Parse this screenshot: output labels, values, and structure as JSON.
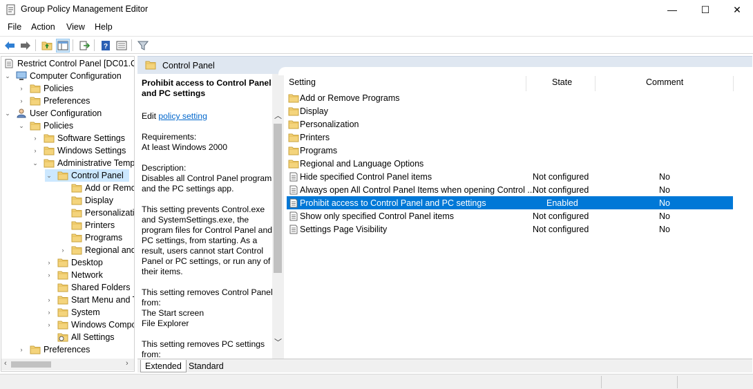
{
  "window": {
    "title": "Group Policy Management Editor",
    "minimize": "—",
    "maximize": "☐",
    "close": "✕"
  },
  "menu": [
    "File",
    "Action",
    "View",
    "Help"
  ],
  "toolbar": [
    "back-icon",
    "forward-icon",
    "up-folder-icon",
    "show-hide-tree-icon",
    "export-list-icon",
    "help-icon",
    "properties-icon",
    "filter-icon"
  ],
  "tree": {
    "root": "Restrict Control Panel [DC01.CC",
    "computer_config": "Computer Configuration",
    "policies": "Policies",
    "preferences": "Preferences",
    "user_config": "User Configuration",
    "software_settings": "Software Settings",
    "windows_settings": "Windows Settings",
    "admin_templates": "Administrative Temp",
    "control_panel": "Control Panel",
    "children": [
      "Add or Remo",
      "Display",
      "Personalizatic",
      "Printers",
      "Programs",
      "Regional and"
    ],
    "desktop": "Desktop",
    "network": "Network",
    "shared_folders": "Shared Folders",
    "start_menu": "Start Menu and T",
    "system": "System",
    "windows_components": "Windows Compc",
    "all_settings": "All Settings",
    "preferences2": "Preferences"
  },
  "header": {
    "title": "Control Panel"
  },
  "description": {
    "heading": "Prohibit access to Control Panel and PC settings",
    "edit_prefix": "Edit ",
    "edit_link": "policy setting ",
    "requirements": "Requirements:\nAt least Windows 2000",
    "description": "Description:\nDisables all Control Panel programs and the PC settings app.",
    "para1": "This setting prevents Control.exe and SystemSettings.exe, the program files for Control Panel and PC settings, from starting. As a result, users cannot start Control Panel or PC settings, or run any of their items.",
    "para2": "This setting removes Control Panel from:\nThe Start screen\nFile Explorer",
    "para3": "This setting removes PC settings from:"
  },
  "columns": {
    "setting": "Setting",
    "state": "State",
    "comment": "Comment"
  },
  "folders": [
    "Add or Remove Programs",
    "Display",
    "Personalization",
    "Printers",
    "Programs",
    "Regional and Language Options"
  ],
  "settings": [
    {
      "name": "Hide specified Control Panel items",
      "state": "Not configured",
      "comment": "No"
    },
    {
      "name": "Always open All Control Panel Items when opening Control ...",
      "state": "Not configured",
      "comment": "No"
    },
    {
      "name": "Prohibit access to Control Panel and PC settings",
      "state": "Enabled",
      "comment": "No"
    },
    {
      "name": "Show only specified Control Panel items",
      "state": "Not configured",
      "comment": "No"
    },
    {
      "name": "Settings Page Visibility",
      "state": "Not configured",
      "comment": "No"
    }
  ],
  "tabs": {
    "extended": "Extended",
    "standard": "Standard"
  },
  "colors": {
    "selection": "#0078d7",
    "tree_selection": "#cce8ff",
    "header_bg": "#dfe7f1",
    "folder": "#e8c15a",
    "link": "#0066cc"
  }
}
